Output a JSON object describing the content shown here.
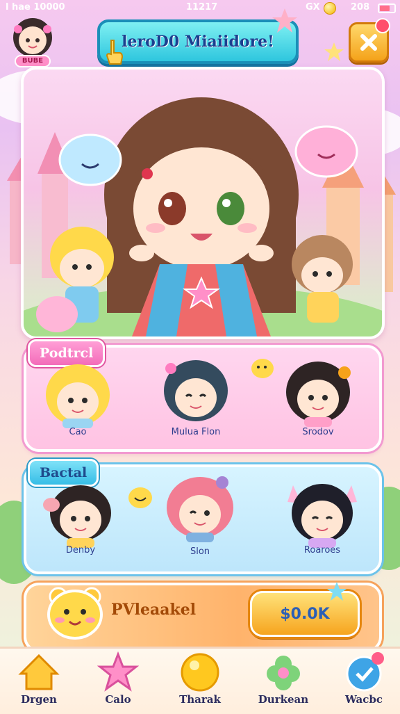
{
  "status_bar": {
    "left": "l hae 10000",
    "center": "11217",
    "right_icon": "GX",
    "coins": "208"
  },
  "header": {
    "profile_badge": "BUBE",
    "title": "leroD0 Miaiidore!",
    "close_icon": "close-icon"
  },
  "sections": [
    {
      "tag": "Podtrcl",
      "color": "#ff9fd6",
      "characters": [
        {
          "name": "Cao"
        },
        {
          "name": "Mulua Flon"
        },
        {
          "name": "Srodov"
        }
      ]
    },
    {
      "tag": "Bactal",
      "color": "#7fe2f8",
      "characters": [
        {
          "name": "Denby"
        },
        {
          "name": "Slon"
        },
        {
          "name": "Roaroes"
        }
      ]
    }
  ],
  "offer": {
    "text": "PVleaakel",
    "price": "$0.0K"
  },
  "nav": [
    {
      "label": "Drgen",
      "icon": "home-icon"
    },
    {
      "label": "Calo",
      "icon": "star-pet-icon"
    },
    {
      "label": "Tharak",
      "icon": "orb-icon"
    },
    {
      "label": "Durkean",
      "icon": "flower-icon"
    },
    {
      "label": "Wacbc",
      "icon": "heart-badge-icon"
    }
  ]
}
